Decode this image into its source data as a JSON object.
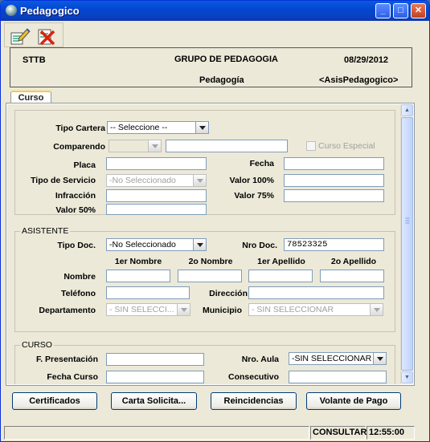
{
  "window": {
    "title": "Pedagogico",
    "buttons": {
      "minimize": "_",
      "maximize": "□",
      "close": "✕"
    }
  },
  "toolbar": {
    "items": [
      {
        "icon": "edit-icon"
      },
      {
        "icon": "cancel-icon"
      }
    ]
  },
  "header": {
    "org": "STTB",
    "group": "GRUPO DE PEDAGOGIA",
    "date": "08/29/2012",
    "module": "Pedagogía",
    "screen": "<AsisPedagogico>"
  },
  "tabs": [
    {
      "label": "Curso",
      "active": true
    }
  ],
  "curso_form": {
    "tipo_cartera_label": "Tipo Cartera",
    "tipo_cartera_value": "-- Seleccione --",
    "comparendo_label": "Comparendo",
    "comparendo_value": "",
    "curso_especial_label": "Curso Especial",
    "placa_label": "Placa",
    "fecha_label": "Fecha",
    "tipo_servicio_label": "Tipo de Servicio",
    "tipo_servicio_value": "-No Seleccionado",
    "valor100_label": "Valor 100%",
    "infraccion_label": "Infracción",
    "valor75_label": "Valor 75%",
    "valor50_label": "Valor 50%"
  },
  "asistente": {
    "legend": "ASISTENTE",
    "tipo_doc_label": "Tipo Doc.",
    "tipo_doc_value": "-No Seleccionado",
    "nro_doc_label": "Nro Doc.",
    "nro_doc_value": "78523325",
    "col_headers": [
      "1er Nombre",
      "2o Nombre",
      "1er Apellido",
      "2o Apellido"
    ],
    "nombre_label": "Nombre",
    "telefono_label": "Teléfono",
    "direccion_label": "Dirección",
    "departamento_label": "Departamento",
    "departamento_value": "- SIN SELECCI...",
    "municipio_label": "Municipio",
    "municipio_value": "- SIN SELECCIONAR"
  },
  "curso": {
    "legend": "CURSO",
    "f_presentacion_label": "F. Presentación",
    "nro_aula_label": "Nro. Aula",
    "nro_aula_value": "-SIN SELECCIONAR",
    "fecha_curso_label": "Fecha Curso",
    "consecutivo_label": "Consecutivo"
  },
  "actions": [
    "Certificados",
    "Carta Solicita...",
    "Reincidencias",
    "Volante de Pago"
  ],
  "status": {
    "message": "",
    "mode": "CONSULTAR",
    "time": "12:55:00"
  },
  "colors": {
    "titlebar": "#0a4fd6",
    "window_bg": "#ece9d8",
    "field_border": "#7f9db9",
    "tab_accent": "#ffc83c"
  }
}
